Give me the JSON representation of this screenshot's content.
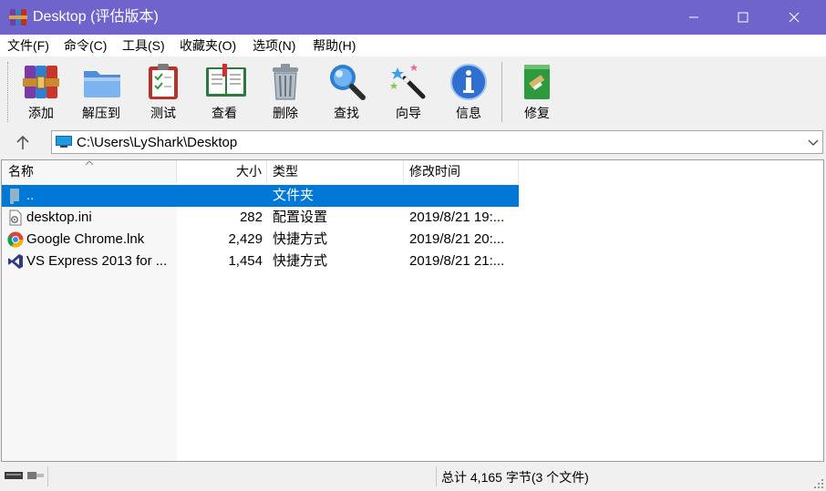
{
  "window": {
    "title": "Desktop (评估版本)",
    "titlebar_color": "#6e64cc",
    "controls": [
      "minimize-icon",
      "maximize-icon",
      "close-icon"
    ]
  },
  "menu": [
    "文件(F)",
    "命令(C)",
    "工具(S)",
    "收藏夹(O)",
    "选项(N)",
    "帮助(H)"
  ],
  "toolbar": {
    "buttons": [
      {
        "label": "添加",
        "icon": "archive-add-icon"
      },
      {
        "label": "解压到",
        "icon": "extract-folder-icon"
      },
      {
        "label": "测试",
        "icon": "test-clipboard-icon"
      },
      {
        "label": "查看",
        "icon": "view-book-icon"
      },
      {
        "label": "删除",
        "icon": "trash-icon"
      },
      {
        "label": "查找",
        "icon": "find-magnifier-icon"
      },
      {
        "label": "向导",
        "icon": "wizard-wand-icon"
      },
      {
        "label": "信息",
        "icon": "info-icon"
      },
      {
        "label": "修复",
        "icon": "repair-icon"
      }
    ]
  },
  "address": {
    "path": "C:\\Users\\LyShark\\Desktop"
  },
  "filelist": {
    "columns": [
      "名称",
      "大小",
      "类型",
      "修改时间"
    ],
    "sort_column": "名称",
    "rows": [
      {
        "name": "..",
        "size": "",
        "type": "文件夹",
        "modified": "",
        "icon": "parent-folder-icon",
        "selected": true
      },
      {
        "name": "desktop.ini",
        "size": "282",
        "type": "配置设置",
        "modified": "2019/8/21 19:...",
        "icon": "ini-file-icon",
        "selected": false
      },
      {
        "name": "Google Chrome.lnk",
        "size": "2,429",
        "type": "快捷方式",
        "modified": "2019/8/21 20:...",
        "icon": "chrome-icon",
        "selected": false
      },
      {
        "name": "VS Express 2013 for ...",
        "size": "1,454",
        "type": "快捷方式",
        "modified": "2019/8/21 21:...",
        "icon": "visual-studio-icon",
        "selected": false
      }
    ],
    "selection_color": "#0078d7"
  },
  "status": {
    "text": "总计 4,165 字节(3 个文件)"
  }
}
